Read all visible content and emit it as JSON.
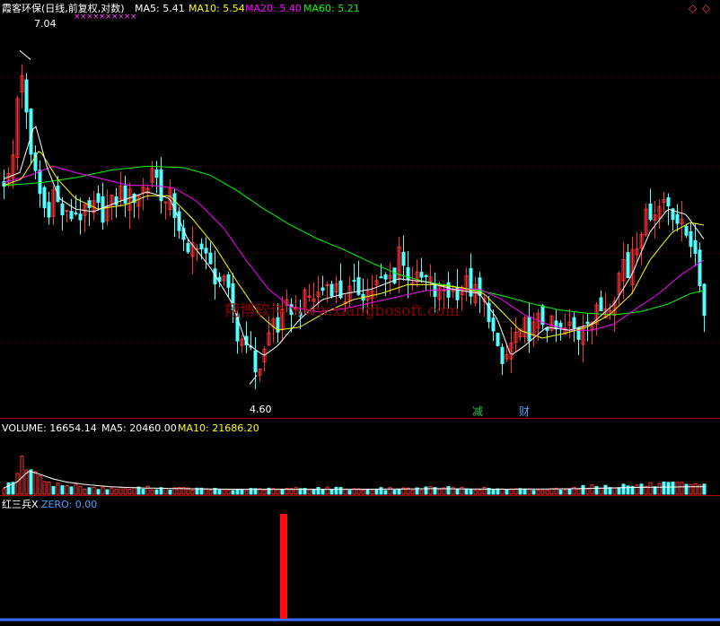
{
  "header": {
    "title": "霞客环保(日线,前复权,对数)",
    "ma_items": [
      {
        "label": "MA5: 5.41",
        "color": "#ffffff"
      },
      {
        "label": "MA10: 5.54",
        "color": "#ffff00"
      },
      {
        "label": "MA20: 5.40",
        "color": "#ff00ff"
      },
      {
        "label": "MA60: 5.21",
        "color": "#00ff00"
      }
    ],
    "controls": [
      "◇",
      "◇"
    ]
  },
  "annotations": {
    "high_label": "7.04",
    "low_label": "4.60",
    "badges": [
      {
        "text": "减",
        "color": "#21c45a"
      },
      {
        "text": "财",
        "color": "#4aa0ff"
      }
    ],
    "watermark": "翔博软件 www.xiangbosoft.com",
    "marker_glyph": "×"
  },
  "volume_panel": {
    "items": [
      {
        "label": "VOLUME: 16654.14",
        "color": "#ffffff"
      },
      {
        "label": "MA5: 20460.00",
        "color": "#ffffff"
      },
      {
        "label": "MA10: 21686.20",
        "color": "#ffff00"
      }
    ]
  },
  "indicator_panel": {
    "items": [
      {
        "label": "红三兵X",
        "color": "#ffffff"
      },
      {
        "label": "ZERO: 0.00",
        "color": "#4aa0ff"
      }
    ]
  },
  "chart_data": {
    "type": "candlestick",
    "scale": "log",
    "ylim": [
      4.35,
      7.4
    ],
    "grid_levels": [
      4.8,
      5.4,
      6.05,
      6.8
    ],
    "colors": {
      "up": "#ff3232",
      "down": "#54ffff",
      "ma5": "#ffffff",
      "ma10": "#ffff00",
      "ma20": "#ff00ff",
      "ma60": "#00ff00",
      "panel_line": "#b00000",
      "zero_line": "#3a6fff"
    },
    "price_anchors": [
      [
        0,
        5.95
      ],
      [
        5,
        5.95
      ],
      [
        12,
        6.2
      ],
      [
        18,
        7.04
      ],
      [
        24,
        6.5
      ],
      [
        30,
        6.1
      ],
      [
        36,
        6.0
      ],
      [
        42,
        5.75
      ],
      [
        48,
        5.7
      ],
      [
        55,
        5.85
      ],
      [
        62,
        5.72
      ],
      [
        70,
        5.65
      ],
      [
        80,
        5.7
      ],
      [
        90,
        5.67
      ],
      [
        100,
        5.72
      ],
      [
        110,
        5.7
      ],
      [
        120,
        5.75
      ],
      [
        130,
        5.85
      ],
      [
        140,
        5.8
      ],
      [
        150,
        5.85
      ],
      [
        160,
        5.9
      ],
      [
        165,
        6.05
      ],
      [
        170,
        5.95
      ],
      [
        175,
        5.85
      ],
      [
        180,
        5.75
      ],
      [
        185,
        5.8
      ],
      [
        190,
        5.7
      ],
      [
        195,
        5.6
      ],
      [
        200,
        5.45
      ],
      [
        205,
        5.35
      ],
      [
        210,
        5.45
      ],
      [
        215,
        5.5
      ],
      [
        222,
        5.4
      ],
      [
        228,
        5.3
      ],
      [
        235,
        5.25
      ],
      [
        242,
        5.2
      ],
      [
        250,
        5.1
      ],
      [
        256,
        5.0
      ],
      [
        262,
        4.75
      ],
      [
        268,
        4.9
      ],
      [
        275,
        4.72
      ],
      [
        282,
        4.62
      ],
      [
        288,
        4.7
      ],
      [
        295,
        4.85
      ],
      [
        300,
        4.95
      ],
      [
        305,
        4.9
      ],
      [
        312,
        4.97
      ],
      [
        318,
        5.05
      ],
      [
        325,
        5.0
      ],
      [
        332,
        5.05
      ],
      [
        340,
        5.1
      ],
      [
        348,
        5.1
      ],
      [
        355,
        5.15
      ],
      [
        362,
        5.2
      ],
      [
        370,
        5.15
      ],
      [
        378,
        5.1
      ],
      [
        385,
        5.12
      ],
      [
        395,
        5.15
      ],
      [
        405,
        5.13
      ],
      [
        415,
        5.18
      ],
      [
        425,
        5.2
      ],
      [
        435,
        5.25
      ],
      [
        440,
        5.45
      ],
      [
        445,
        5.3
      ],
      [
        452,
        5.25
      ],
      [
        460,
        5.2
      ],
      [
        468,
        5.22
      ],
      [
        475,
        5.18
      ],
      [
        482,
        5.1
      ],
      [
        490,
        5.15
      ],
      [
        498,
        5.12
      ],
      [
        505,
        5.15
      ],
      [
        512,
        5.2
      ],
      [
        520,
        5.15
      ],
      [
        528,
        5.1
      ],
      [
        535,
        5.05
      ],
      [
        540,
        5.0
      ],
      [
        545,
        4.85
      ],
      [
        550,
        4.72
      ],
      [
        555,
        4.66
      ],
      [
        560,
        4.72
      ],
      [
        565,
        4.78
      ],
      [
        570,
        4.85
      ],
      [
        575,
        4.82
      ],
      [
        580,
        4.9
      ],
      [
        588,
        4.87
      ],
      [
        595,
        4.93
      ],
      [
        602,
        4.95
      ],
      [
        610,
        4.9
      ],
      [
        618,
        4.86
      ],
      [
        625,
        4.88
      ],
      [
        632,
        4.9
      ],
      [
        640,
        4.85
      ],
      [
        648,
        5.0
      ],
      [
        655,
        4.95
      ],
      [
        662,
        5.0
      ],
      [
        670,
        5.05
      ],
      [
        678,
        5.1
      ],
      [
        685,
        5.25
      ],
      [
        690,
        5.35
      ],
      [
        695,
        5.25
      ],
      [
        700,
        5.45
      ],
      [
        705,
        5.5
      ],
      [
        710,
        5.6
      ],
      [
        716,
        5.65
      ],
      [
        722,
        5.75
      ],
      [
        728,
        5.7
      ],
      [
        734,
        5.8
      ],
      [
        740,
        5.77
      ],
      [
        746,
        5.7
      ],
      [
        752,
        5.6
      ],
      [
        758,
        5.55
      ],
      [
        764,
        5.5
      ],
      [
        770,
        5.45
      ],
      [
        775,
        5.1
      ],
      [
        780,
        5.0
      ]
    ],
    "ma_anchors": {
      "ma5": [
        [
          0,
          5.95
        ],
        [
          18,
          6.0
        ],
        [
          35,
          6.4
        ],
        [
          48,
          6.05
        ],
        [
          62,
          5.8
        ],
        [
          80,
          5.72
        ],
        [
          100,
          5.7
        ],
        [
          130,
          5.78
        ],
        [
          160,
          5.85
        ],
        [
          185,
          5.8
        ],
        [
          205,
          5.5
        ],
        [
          230,
          5.3
        ],
        [
          255,
          5.05
        ],
        [
          270,
          4.8
        ],
        [
          290,
          4.72
        ],
        [
          305,
          4.78
        ],
        [
          330,
          4.95
        ],
        [
          355,
          5.08
        ],
        [
          380,
          5.12
        ],
        [
          410,
          5.15
        ],
        [
          440,
          5.22
        ],
        [
          470,
          5.2
        ],
        [
          500,
          5.15
        ],
        [
          530,
          5.12
        ],
        [
          550,
          4.95
        ],
        [
          565,
          4.72
        ],
        [
          580,
          4.78
        ],
        [
          605,
          4.9
        ],
        [
          630,
          4.88
        ],
        [
          655,
          4.92
        ],
        [
          680,
          5.05
        ],
        [
          700,
          5.25
        ],
        [
          720,
          5.55
        ],
        [
          740,
          5.72
        ],
        [
          760,
          5.68
        ],
        [
          780,
          5.5
        ]
      ],
      "ma10": [
        [
          0,
          5.9
        ],
        [
          20,
          5.95
        ],
        [
          40,
          6.18
        ],
        [
          60,
          5.95
        ],
        [
          80,
          5.8
        ],
        [
          105,
          5.72
        ],
        [
          135,
          5.75
        ],
        [
          160,
          5.82
        ],
        [
          185,
          5.82
        ],
        [
          210,
          5.65
        ],
        [
          235,
          5.45
        ],
        [
          260,
          5.2
        ],
        [
          285,
          4.98
        ],
        [
          305,
          4.88
        ],
        [
          330,
          4.9
        ],
        [
          360,
          5.0
        ],
        [
          390,
          5.08
        ],
        [
          420,
          5.12
        ],
        [
          450,
          5.18
        ],
        [
          480,
          5.18
        ],
        [
          510,
          5.16
        ],
        [
          535,
          5.12
        ],
        [
          555,
          5.0
        ],
        [
          575,
          4.88
        ],
        [
          600,
          4.83
        ],
        [
          625,
          4.86
        ],
        [
          650,
          4.9
        ],
        [
          675,
          4.98
        ],
        [
          700,
          5.12
        ],
        [
          720,
          5.35
        ],
        [
          745,
          5.55
        ],
        [
          765,
          5.62
        ],
        [
          780,
          5.6
        ]
      ],
      "ma20": [
        [
          0,
          5.92
        ],
        [
          30,
          5.98
        ],
        [
          55,
          6.05
        ],
        [
          80,
          6.0
        ],
        [
          110,
          5.95
        ],
        [
          140,
          5.9
        ],
        [
          165,
          5.9
        ],
        [
          190,
          5.88
        ],
        [
          215,
          5.78
        ],
        [
          245,
          5.58
        ],
        [
          270,
          5.35
        ],
        [
          295,
          5.15
        ],
        [
          320,
          5.03
        ],
        [
          350,
          5.0
        ],
        [
          380,
          5.02
        ],
        [
          410,
          5.06
        ],
        [
          440,
          5.1
        ],
        [
          470,
          5.14
        ],
        [
          500,
          5.15
        ],
        [
          530,
          5.15
        ],
        [
          555,
          5.08
        ],
        [
          580,
          4.98
        ],
        [
          605,
          4.92
        ],
        [
          630,
          4.88
        ],
        [
          655,
          4.88
        ],
        [
          680,
          4.92
        ],
        [
          705,
          5.02
        ],
        [
          730,
          5.12
        ],
        [
          755,
          5.25
        ],
        [
          780,
          5.35
        ]
      ],
      "ma60": [
        [
          0,
          5.9
        ],
        [
          40,
          5.92
        ],
        [
          80,
          5.96
        ],
        [
          120,
          6.02
        ],
        [
          160,
          6.05
        ],
        [
          200,
          6.04
        ],
        [
          230,
          5.98
        ],
        [
          260,
          5.86
        ],
        [
          290,
          5.72
        ],
        [
          320,
          5.6
        ],
        [
          350,
          5.5
        ],
        [
          380,
          5.42
        ],
        [
          410,
          5.33
        ],
        [
          440,
          5.25
        ],
        [
          470,
          5.2
        ],
        [
          500,
          5.17
        ],
        [
          530,
          5.14
        ],
        [
          560,
          5.1
        ],
        [
          590,
          5.05
        ],
        [
          620,
          5.01
        ],
        [
          650,
          4.99
        ],
        [
          680,
          4.98
        ],
        [
          710,
          5.0
        ],
        [
          740,
          5.05
        ],
        [
          765,
          5.12
        ],
        [
          780,
          5.14
        ]
      ]
    },
    "volume_anchors": {
      "volume": [
        [
          0,
          0.12
        ],
        [
          10,
          0.22
        ],
        [
          18,
          0.55
        ],
        [
          25,
          0.35
        ],
        [
          30,
          0.48
        ],
        [
          38,
          0.22
        ],
        [
          45,
          0.28
        ],
        [
          52,
          0.18
        ],
        [
          60,
          0.15
        ],
        [
          75,
          0.14
        ],
        [
          100,
          0.1
        ],
        [
          130,
          0.09
        ],
        [
          160,
          0.1
        ],
        [
          200,
          0.09
        ],
        [
          250,
          0.07
        ],
        [
          300,
          0.08
        ],
        [
          350,
          0.1
        ],
        [
          400,
          0.08
        ],
        [
          450,
          0.09
        ],
        [
          500,
          0.1
        ],
        [
          550,
          0.08
        ],
        [
          600,
          0.07
        ],
        [
          650,
          0.12
        ],
        [
          700,
          0.14
        ],
        [
          740,
          0.16
        ],
        [
          780,
          0.13
        ]
      ],
      "ma": [
        [
          0,
          0.1
        ],
        [
          15,
          0.2
        ],
        [
          28,
          0.38
        ],
        [
          40,
          0.33
        ],
        [
          55,
          0.25
        ],
        [
          70,
          0.2
        ],
        [
          90,
          0.16
        ],
        [
          120,
          0.12
        ],
        [
          160,
          0.1
        ],
        [
          200,
          0.09
        ],
        [
          260,
          0.08
        ],
        [
          320,
          0.08
        ],
        [
          400,
          0.08
        ],
        [
          480,
          0.09
        ],
        [
          560,
          0.08
        ],
        [
          640,
          0.09
        ],
        [
          700,
          0.11
        ],
        [
          760,
          0.12
        ],
        [
          780,
          0.12
        ]
      ]
    },
    "marker_days": [
      78,
      85,
      92,
      99,
      106,
      113,
      120,
      127,
      134,
      141
    ],
    "signal": {
      "x_day": 312,
      "value": 1,
      "color": "#ff1010"
    }
  }
}
